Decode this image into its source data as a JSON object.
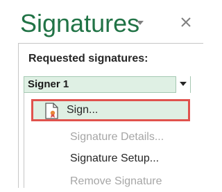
{
  "pane": {
    "title": "Signatures"
  },
  "requested": {
    "label": "Requested signatures:",
    "signer": "Signer 1"
  },
  "menu": {
    "sign": "Sign...",
    "details": "Signature Details...",
    "setup": "Signature Setup...",
    "remove": "Remove Signature"
  },
  "colors": {
    "accent": "#217346",
    "selected_bg": "#dfefe3",
    "highlight_border": "#e0524d",
    "disabled_text": "#a6a6a6"
  },
  "icons": {
    "pane_menu": "chevron-down-icon",
    "close": "close-icon",
    "sign": "signature-document-icon",
    "dropdown": "caret-down-icon"
  }
}
